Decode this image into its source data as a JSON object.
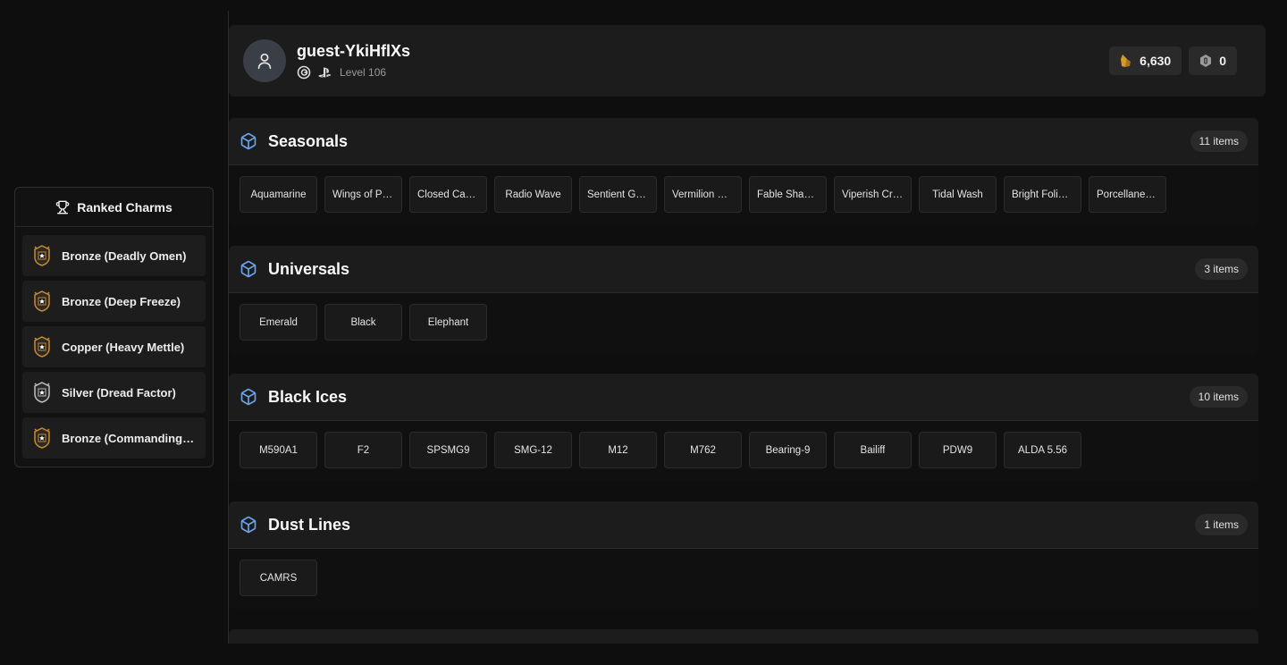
{
  "profile": {
    "username": "guest-YkiHflXs",
    "level": "Level 106",
    "platform_icons": [
      "ubisoft-icon",
      "playstation-icon"
    ],
    "currencies": [
      {
        "icon": "renown-icon",
        "value": "6,630"
      },
      {
        "icon": "r6-credits-icon",
        "value": "0"
      }
    ]
  },
  "ranked_charms": {
    "title": "Ranked Charms",
    "items": [
      {
        "label": "Bronze (Deadly Omen)",
        "tier": "bronze"
      },
      {
        "label": "Bronze (Deep Freeze)",
        "tier": "bronze"
      },
      {
        "label": "Copper (Heavy Mettle)",
        "tier": "copper"
      },
      {
        "label": "Silver (Dread Factor)",
        "tier": "silver"
      },
      {
        "label": "Bronze (Commanding Force)",
        "tier": "bronze"
      }
    ]
  },
  "sections": [
    {
      "title": "Seasonals",
      "count": "11 items",
      "items": [
        "Aquamarine",
        "Wings of Prey",
        "Closed Casket",
        "Radio Wave",
        "Sentient Gold",
        "Vermilion Viper",
        "Fable Shaper",
        "Viperish Crown",
        "Tidal Wash",
        "Bright Foliage",
        "Porcellaneous"
      ]
    },
    {
      "title": "Universals",
      "count": "3 items",
      "items": [
        "Emerald",
        "Black",
        "Elephant"
      ]
    },
    {
      "title": "Black Ices",
      "count": "10 items",
      "items": [
        "M590A1",
        "F2",
        "SPSMG9",
        "SMG-12",
        "M12",
        "M762",
        "Bearing-9",
        "Bailiff",
        "PDW9",
        "ALDA 5.56"
      ]
    },
    {
      "title": "Dust Lines",
      "count": "1 items",
      "items": [
        "CAMRS"
      ]
    }
  ],
  "colors": {
    "accent_icon": "#6aa3ea",
    "gold": "#d49a2a"
  }
}
